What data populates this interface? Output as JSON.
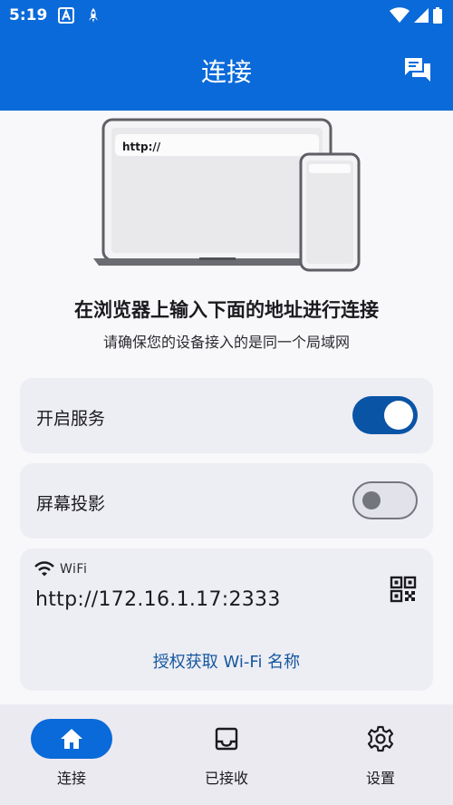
{
  "status_bar": {
    "time": "5:19",
    "left_icons": [
      "font-notification-icon",
      "rocket-notification-icon"
    ],
    "right_icons": [
      "wifi-icon",
      "cellular-signal-icon",
      "battery-icon"
    ]
  },
  "app_bar": {
    "title": "连接",
    "action_icon": "feedback-icon"
  },
  "illustration": {
    "browser_url": "http://"
  },
  "headline": "在浏览器上输入下面的地址进行连接",
  "subline": "请确保您的设备接入的是同一个局域网",
  "settings": {
    "service": {
      "label": "开启服务",
      "enabled": true
    },
    "projection": {
      "label": "屏幕投影",
      "enabled": false
    }
  },
  "connection": {
    "network_label": "WiFi",
    "network_icon": "wifi-icon",
    "address": "http://172.16.1.17:2333",
    "qr_icon": "qr-code-icon",
    "auth_link": "授权获取 Wi-Fi 名称"
  },
  "bottom_nav": [
    {
      "label": "连接",
      "icon": "home-icon",
      "active": true
    },
    {
      "label": "已接收",
      "icon": "inbox-icon",
      "active": false
    },
    {
      "label": "设置",
      "icon": "gear-icon",
      "active": false
    }
  ],
  "colors": {
    "primary": "#0a6ad9",
    "switch_on": "#0a54a6",
    "link": "#16589f",
    "card": "#ededf4",
    "background": "#f8f8fb"
  }
}
